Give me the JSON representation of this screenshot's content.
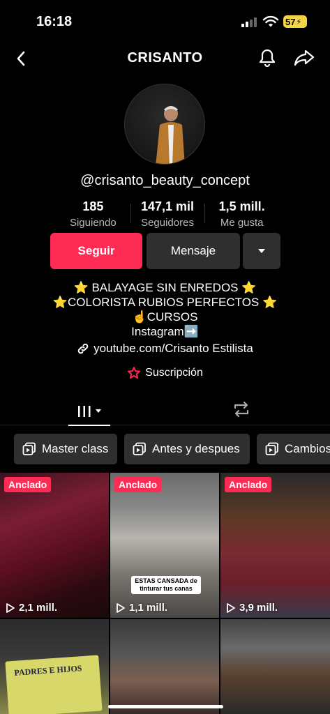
{
  "status_bar": {
    "time": "16:18",
    "battery": "57"
  },
  "header": {
    "title": "CRISANTO"
  },
  "profile": {
    "username": "@crisanto_beauty_concept",
    "stats": [
      {
        "value": "185",
        "label": "Siguiendo"
      },
      {
        "value": "147,1 mil",
        "label": "Seguidores"
      },
      {
        "value": "1,5 mill.",
        "label": "Me gusta"
      }
    ],
    "follow_label": "Seguir",
    "message_label": "Mensaje",
    "bio_lines": [
      "⭐ BALAYAGE SIN ENREDOS ⭐",
      "⭐COLORISTA RUBIOS PERFECTOS ⭐",
      "☝️CURSOS",
      "Instagram➡️"
    ],
    "link": "youtube.com/Crisanto Estilista",
    "subscription": "Suscripción"
  },
  "playlists": [
    {
      "label": "Master class"
    },
    {
      "label": "Antes y despues"
    },
    {
      "label": "Cambios"
    }
  ],
  "videos": [
    {
      "pinned": "Anclado",
      "views": "2,1 mill."
    },
    {
      "pinned": "Anclado",
      "views": "1,1 mill.",
      "caption": "ESTAS CANSADA de tinturar tus canas"
    },
    {
      "pinned": "Anclado",
      "views": "3,9 mill."
    },
    {
      "ticket_text": "PADRES E HIJOS"
    }
  ],
  "colors": {
    "accent": "#fe2c55",
    "button_dark": "#2f2f2f",
    "background": "#000000"
  }
}
